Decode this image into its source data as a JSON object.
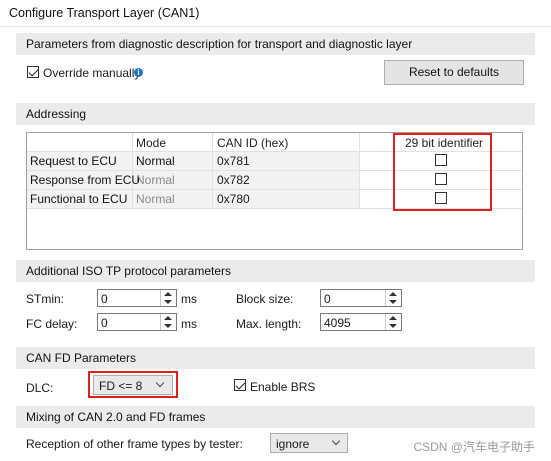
{
  "window": {
    "title": "Configure Transport Layer (CAN1)"
  },
  "params_section": {
    "header": "Parameters from diagnostic description for transport and diagnostic layer",
    "override_label": "Override manually",
    "override_checked": true,
    "info_icon": "info-icon",
    "reset_label": "Reset to defaults"
  },
  "addressing": {
    "header": "Addressing",
    "columns": [
      "Mode",
      "CAN ID (hex)",
      "29 bit identifier"
    ],
    "rows": [
      {
        "label": "Request to ECU",
        "mode": "Normal",
        "can_id": "0x781",
        "bit29": false
      },
      {
        "label": "Response from ECU",
        "mode": "Normal",
        "can_id": "0x782",
        "bit29": false
      },
      {
        "label": "Functional to ECU",
        "mode": "Normal",
        "can_id": "0x780",
        "bit29": false
      }
    ]
  },
  "iso_tp": {
    "header": "Additional ISO TP protocol parameters",
    "stmin_label": "STmin:",
    "stmin_value": "0",
    "stmin_unit": "ms",
    "fcdelay_label": "FC delay:",
    "fcdelay_value": "0",
    "fcdelay_unit": "ms",
    "blocksize_label": "Block size:",
    "blocksize_value": "0",
    "maxlength_label": "Max. length:",
    "maxlength_value": "4095"
  },
  "canfd": {
    "header": "CAN FD Parameters",
    "dlc_label": "DLC:",
    "dlc_value": "FD <= 8",
    "brs_label": "Enable BRS",
    "brs_checked": true
  },
  "mixing": {
    "header": "Mixing of CAN 2.0 and FD frames",
    "reception_label": "Reception of other frame types by tester:",
    "reception_value": "ignore"
  },
  "watermark": "CSDN @汽车电子助手",
  "colors": {
    "highlight": "#e0201b",
    "header_bg": "#ebebeb",
    "info": "#1f73c8"
  }
}
